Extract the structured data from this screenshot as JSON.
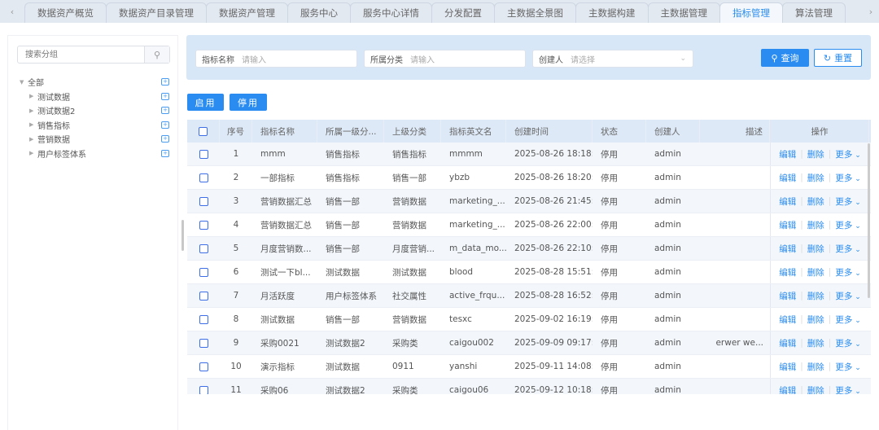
{
  "tabs": [
    "数据资产概览",
    "数据资产目录管理",
    "数据资产管理",
    "服务中心",
    "服务中心详情",
    "分发配置",
    "主数据全景图",
    "主数据构建",
    "主数据管理",
    "指标管理",
    "算法管理"
  ],
  "active_tab": 9,
  "sidebar": {
    "search_placeholder": "搜索分组",
    "root": "全部",
    "items": [
      "测试数据",
      "测试数据2",
      "销售指标",
      "营销数据",
      "用户标签体系"
    ]
  },
  "filter": {
    "name_label": "指标名称",
    "name_placeholder": "请输入",
    "category_label": "所属分类",
    "category_placeholder": "请输入",
    "creator_label": "创建人",
    "creator_placeholder": "请选择",
    "query": "查询",
    "reset": "重置"
  },
  "actions": {
    "enable": "启用",
    "disable": "停用"
  },
  "table": {
    "headers": [
      "序号",
      "指标名称",
      "所属一级分...",
      "上级分类",
      "指标英文名",
      "创建时间",
      "状态",
      "创建人",
      "描述",
      "操作"
    ],
    "row_actions": {
      "edit": "编辑",
      "delete": "删除",
      "more": "更多"
    },
    "rows": [
      [
        "1",
        "mmm",
        "销售指标",
        "销售指标",
        "mmmm",
        "2025-08-26 18:18:27",
        "停用",
        "admin",
        ""
      ],
      [
        "2",
        "一部指标",
        "销售指标",
        "销售一部",
        "ybzb",
        "2025-08-26 18:20:07",
        "停用",
        "admin",
        ""
      ],
      [
        "3",
        "营销数据汇总",
        "销售一部",
        "营销数据",
        "marketing_...",
        "2025-08-26 21:45:12",
        "停用",
        "admin",
        ""
      ],
      [
        "4",
        "营销数据汇总",
        "销售一部",
        "营销数据",
        "marketing_...",
        "2025-08-26 22:00:54",
        "停用",
        "admin",
        ""
      ],
      [
        "5",
        "月度营销数...",
        "销售一部",
        "月度营销...",
        "m_data_mo...",
        "2025-08-26 22:10:48",
        "停用",
        "admin",
        ""
      ],
      [
        "6",
        "测试一下bl...",
        "测试数据",
        "测试数据",
        "blood",
        "2025-08-28 15:51:05",
        "停用",
        "admin",
        ""
      ],
      [
        "7",
        "月活跃度",
        "用户标签体系",
        "社交属性",
        "active_frqu...",
        "2025-08-28 16:52:46",
        "停用",
        "admin",
        ""
      ],
      [
        "8",
        "测试数据",
        "销售一部",
        "营销数据",
        "tesxc",
        "2025-09-02 16:19:25",
        "停用",
        "admin",
        ""
      ],
      [
        "9",
        "采购0021",
        "测试数据2",
        "采购类",
        "caigou002",
        "2025-09-09 09:17:12",
        "停用",
        "admin",
        "erwer we..."
      ],
      [
        "10",
        "演示指标",
        "测试数据",
        "0911",
        "yanshi",
        "2025-09-11 14:08:45",
        "停用",
        "admin",
        ""
      ],
      [
        "11",
        "采购06",
        "测试数据2",
        "采购类",
        "caigou06",
        "2025-09-12 10:18:15",
        "停用",
        "admin",
        ""
      ]
    ]
  }
}
